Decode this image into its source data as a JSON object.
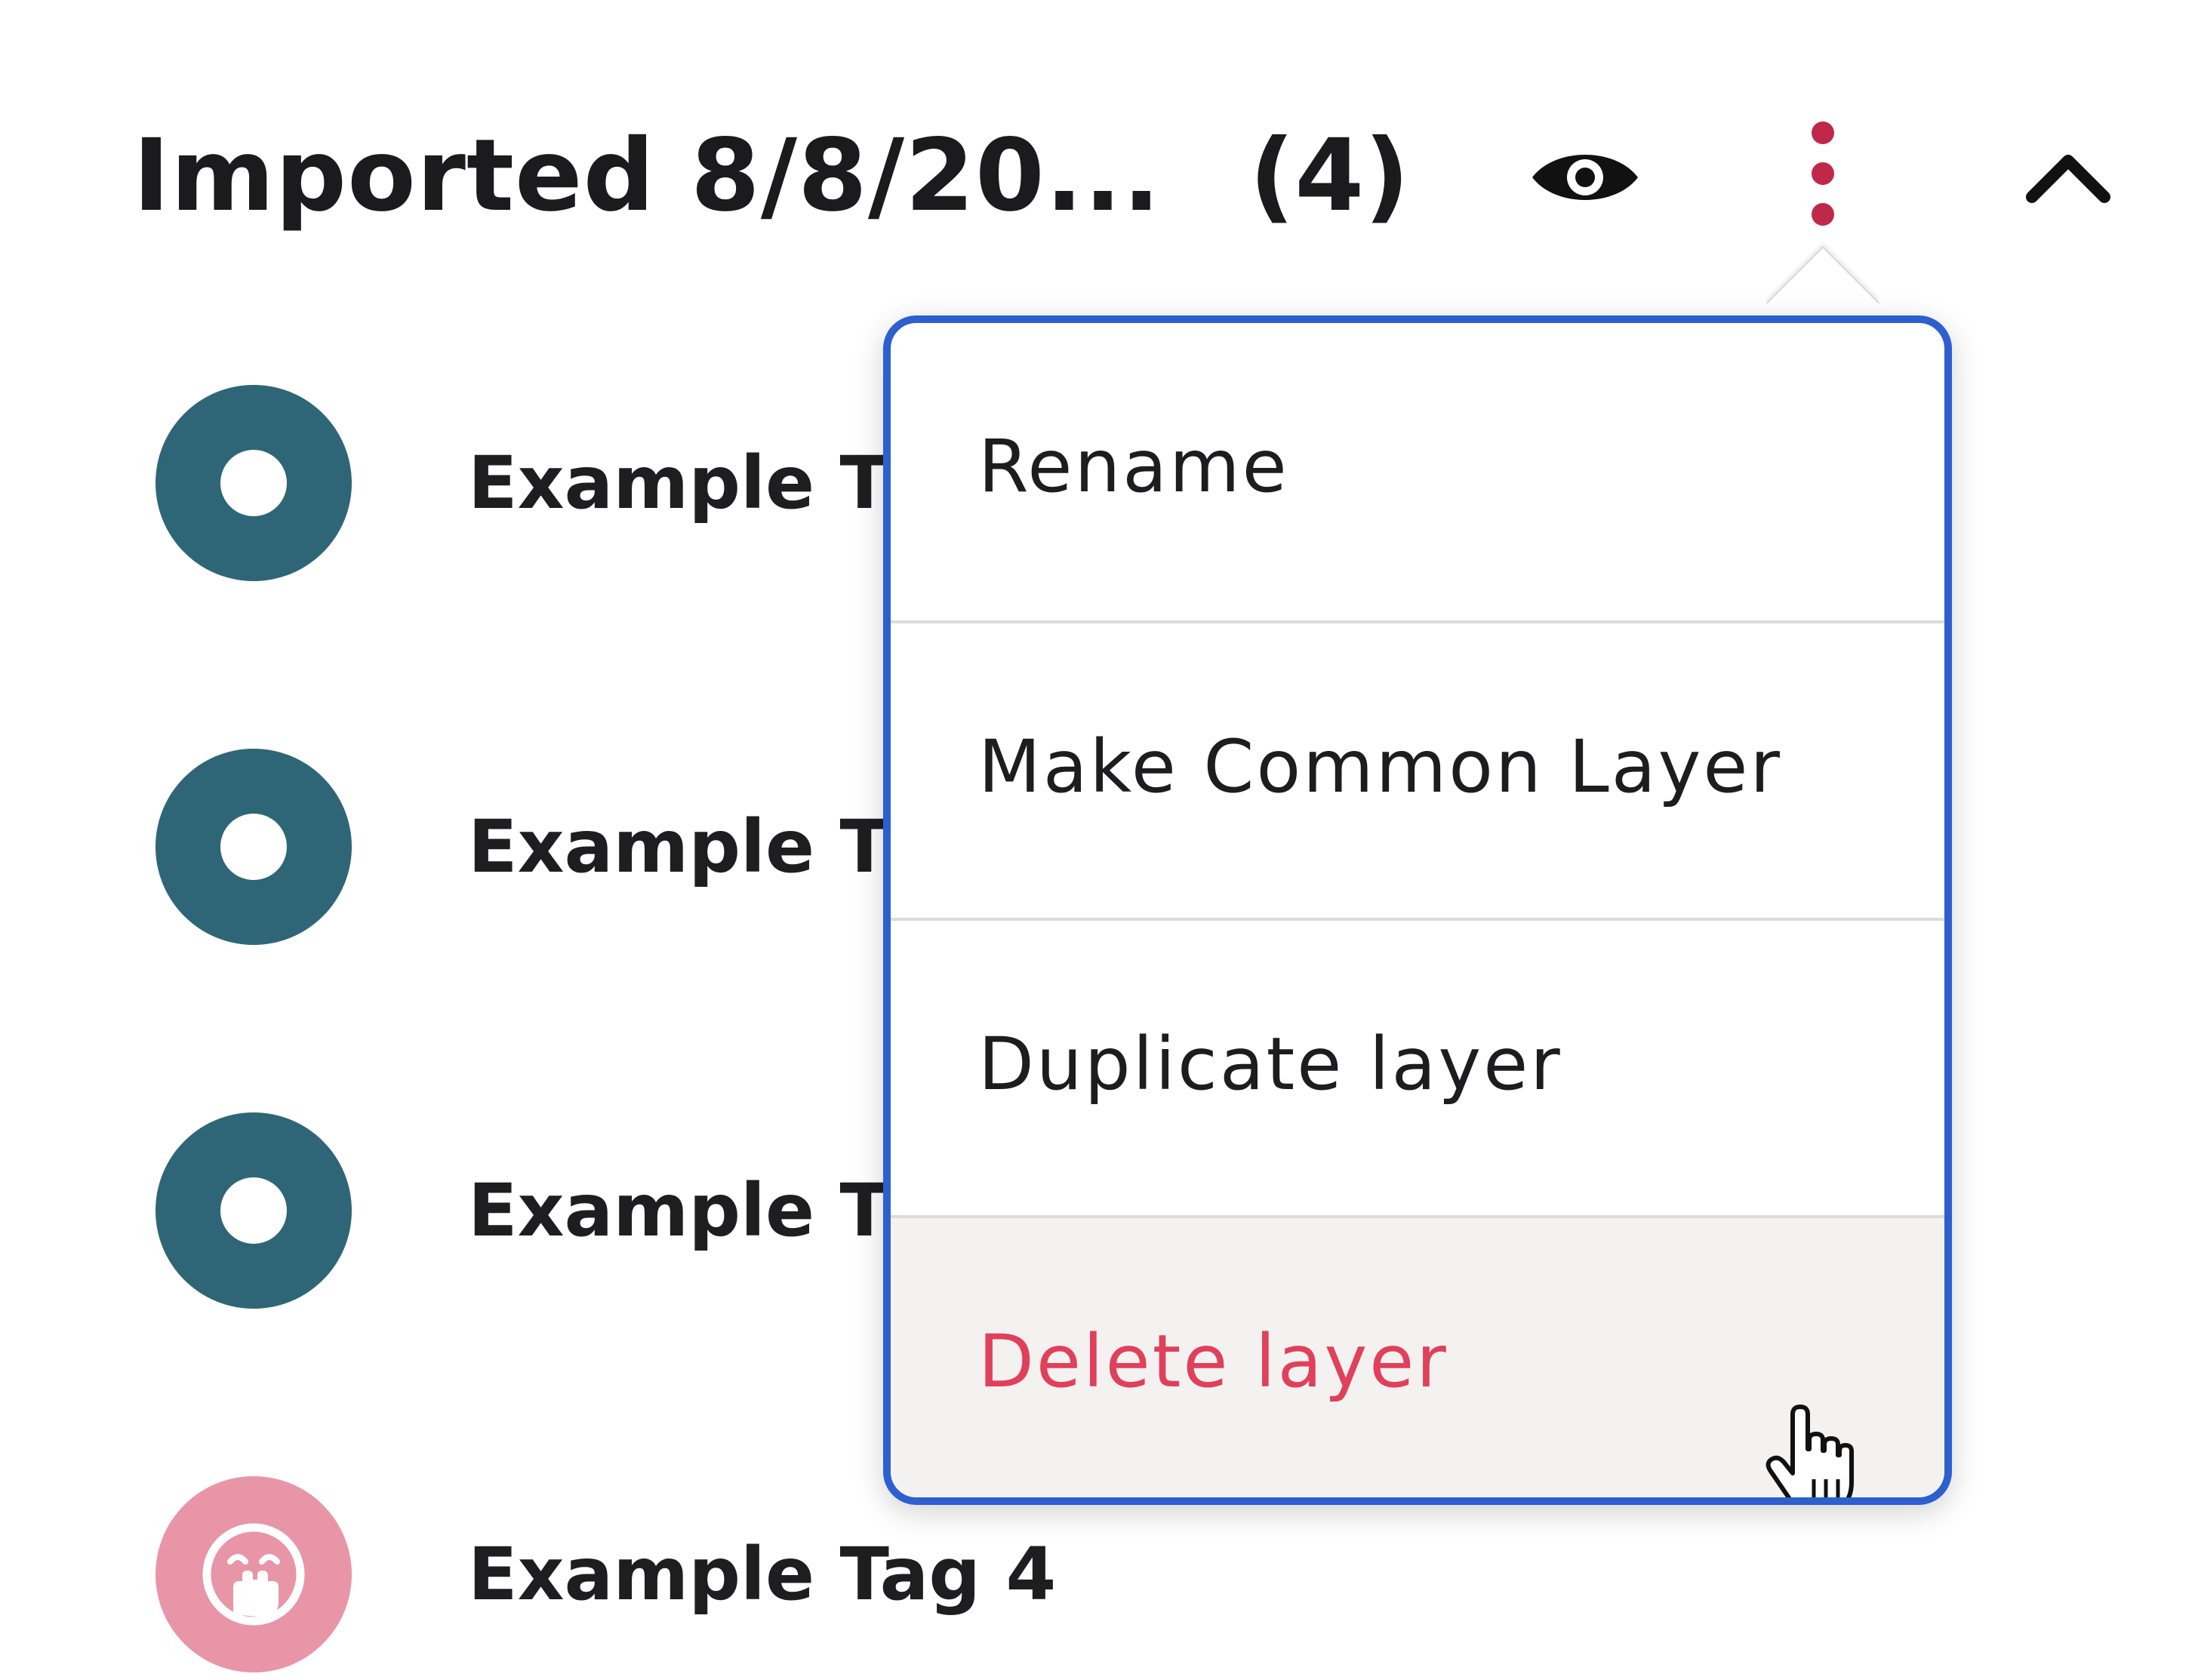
{
  "layer": {
    "title": "Imported 8/8/20...",
    "count": "(4)"
  },
  "header_icons": {
    "visibility": "eye-icon",
    "more": "kebab-vertical-icon",
    "collapse": "chevron-up-icon"
  },
  "tags": [
    {
      "label": "Example T",
      "icon": "ring-marker-icon",
      "color": "#2e6677"
    },
    {
      "label": "Example T",
      "icon": "ring-marker-icon",
      "color": "#2e6677"
    },
    {
      "label": "Example T",
      "icon": "ring-marker-icon",
      "color": "#2e6677"
    },
    {
      "label": "Example Tag 4",
      "icon": "hand-over-mouth-emoji-icon",
      "color": "#e895a8"
    }
  ],
  "menu": {
    "items": [
      {
        "label": "Rename"
      },
      {
        "label": "Make Common Layer"
      },
      {
        "label": "Duplicate layer"
      },
      {
        "label": "Delete layer",
        "state": "hovered",
        "color": "#e0405a"
      }
    ]
  },
  "colors": {
    "accent_border": "#2d5fcf",
    "kebab": "#c0284a",
    "danger": "#e0405a",
    "hover_bg": "#f3f2f1"
  }
}
